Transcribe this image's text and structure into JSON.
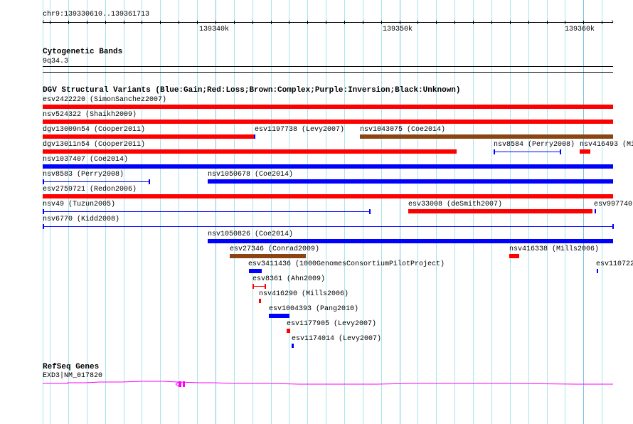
{
  "ruler": {
    "region": "chr9:139330610..139361713",
    "ticks": [
      "139340k",
      "139350k",
      "139360k"
    ]
  },
  "tracks": {
    "cyto": {
      "title": "Cytogenetic Bands",
      "band": "9q34.3"
    },
    "dgv": {
      "title": "DGV Structural Variants (Blue:Gain;Red:Loss;Brown:Complex;Purple:Inversion;Black:Unknown)"
    },
    "refseq": {
      "title": "RefSeq Genes",
      "gene": "EXD3|NM_017820"
    }
  },
  "colors": {
    "gain": "#0000ff",
    "loss": "#ff0000",
    "complex": "#8b4513",
    "gene": "#ff00ff",
    "grid": "#a8e4ec"
  },
  "features": [
    {
      "label": "esv2422220 (SimonSanchez2007)",
      "type": "loss"
    },
    {
      "label": "nsv524322 (Shaikh2009)",
      "type": "loss"
    },
    {
      "label": "dgv13009n54 (Cooper2011)",
      "type": "loss"
    },
    {
      "label": "esv1197738 (Levy2007)",
      "type": "gain"
    },
    {
      "label": "nsv1043075 (Coe2014)",
      "type": "complex"
    },
    {
      "label": "dgv13011n54 (Cooper2011)",
      "type": "loss"
    },
    {
      "label": "nsv8584 (Perry2008)",
      "type": "gain"
    },
    {
      "label": "nsv416493 (Mi",
      "type": "loss"
    },
    {
      "label": "nsv1037407 (Coe2014)",
      "type": "gain"
    },
    {
      "label": "nsv8583 (Perry2008)",
      "type": "gain"
    },
    {
      "label": "nsv1050678 (Coe2014)",
      "type": "gain"
    },
    {
      "label": "esv2759721 (Redon2006)",
      "type": "loss"
    },
    {
      "label": "nsv49 (Tuzun2005)",
      "type": "gain"
    },
    {
      "label": "esv33008 (deSmith2007)",
      "type": "loss"
    },
    {
      "label": "esv997740",
      "type": "gain"
    },
    {
      "label": "nsv6770 (Kidd2008)",
      "type": "gain"
    },
    {
      "label": "nsv1050826 (Coe2014)",
      "type": "gain"
    },
    {
      "label": "esv27346 (Conrad2009)",
      "type": "complex"
    },
    {
      "label": "nsv416338 (Mills2006)",
      "type": "loss"
    },
    {
      "label": "esv3411436 (1000GenomesConsortiumPilotProject)",
      "type": "gain"
    },
    {
      "label": "esv110722",
      "type": "gain"
    },
    {
      "label": "esv8361 (Ahn2009)",
      "type": "loss"
    },
    {
      "label": "nsv416290 (Mills2006)",
      "type": "loss"
    },
    {
      "label": "esv1004393 (Pang2010)",
      "type": "gain"
    },
    {
      "label": "esv1177905 (Levy2007)",
      "type": "loss"
    },
    {
      "label": "esv1174014 (Levy2007)",
      "type": "gain"
    }
  ]
}
